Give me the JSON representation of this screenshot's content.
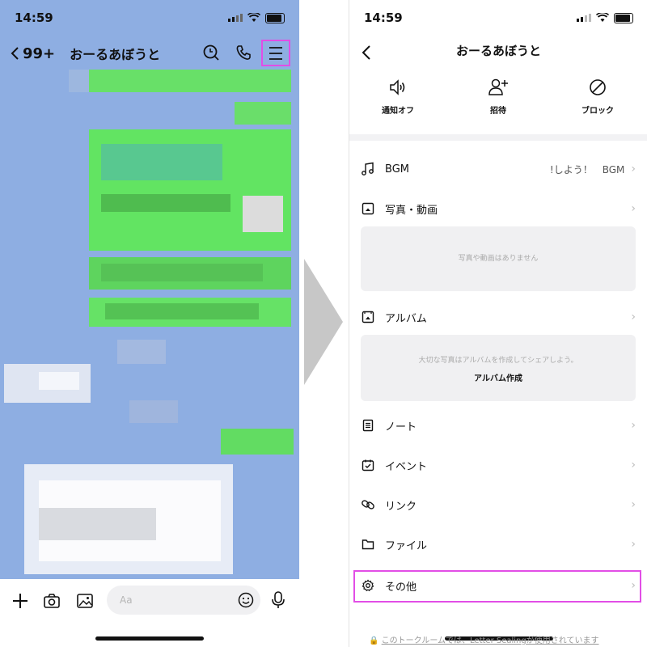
{
  "status": {
    "time": "14:59"
  },
  "chat": {
    "back_count": "99+",
    "title": "おーるあぼうと",
    "input_placeholder": "Aa"
  },
  "settings": {
    "title": "おーるあぼうと",
    "quick_actions": [
      {
        "label": "通知オフ",
        "icon": "speaker-icon"
      },
      {
        "label": "招待",
        "icon": "add-user-icon"
      },
      {
        "label": "ブロック",
        "icon": "block-icon"
      }
    ],
    "bgm": {
      "label": "BGM",
      "value": "!しよう！　BGM"
    },
    "photos": {
      "label": "写真・動画",
      "empty": "写真や動画はありません"
    },
    "album": {
      "label": "アルバム",
      "empty": "大切な写真はアルバムを作成してシェアしよう。",
      "create": "アルバム作成"
    },
    "items": [
      {
        "label": "ノート",
        "icon": "note-icon"
      },
      {
        "label": "イベント",
        "icon": "calendar-icon"
      },
      {
        "label": "リンク",
        "icon": "link-icon"
      },
      {
        "label": "ファイル",
        "icon": "folder-icon"
      },
      {
        "label": "その他",
        "icon": "gear-icon"
      }
    ],
    "footer": "このトークルームでは、Letter Sealingが使用されています"
  },
  "colors": {
    "highlight": "#e24ee6",
    "chat_bg": "#8eaee2",
    "bubble": "#5ee35e"
  }
}
